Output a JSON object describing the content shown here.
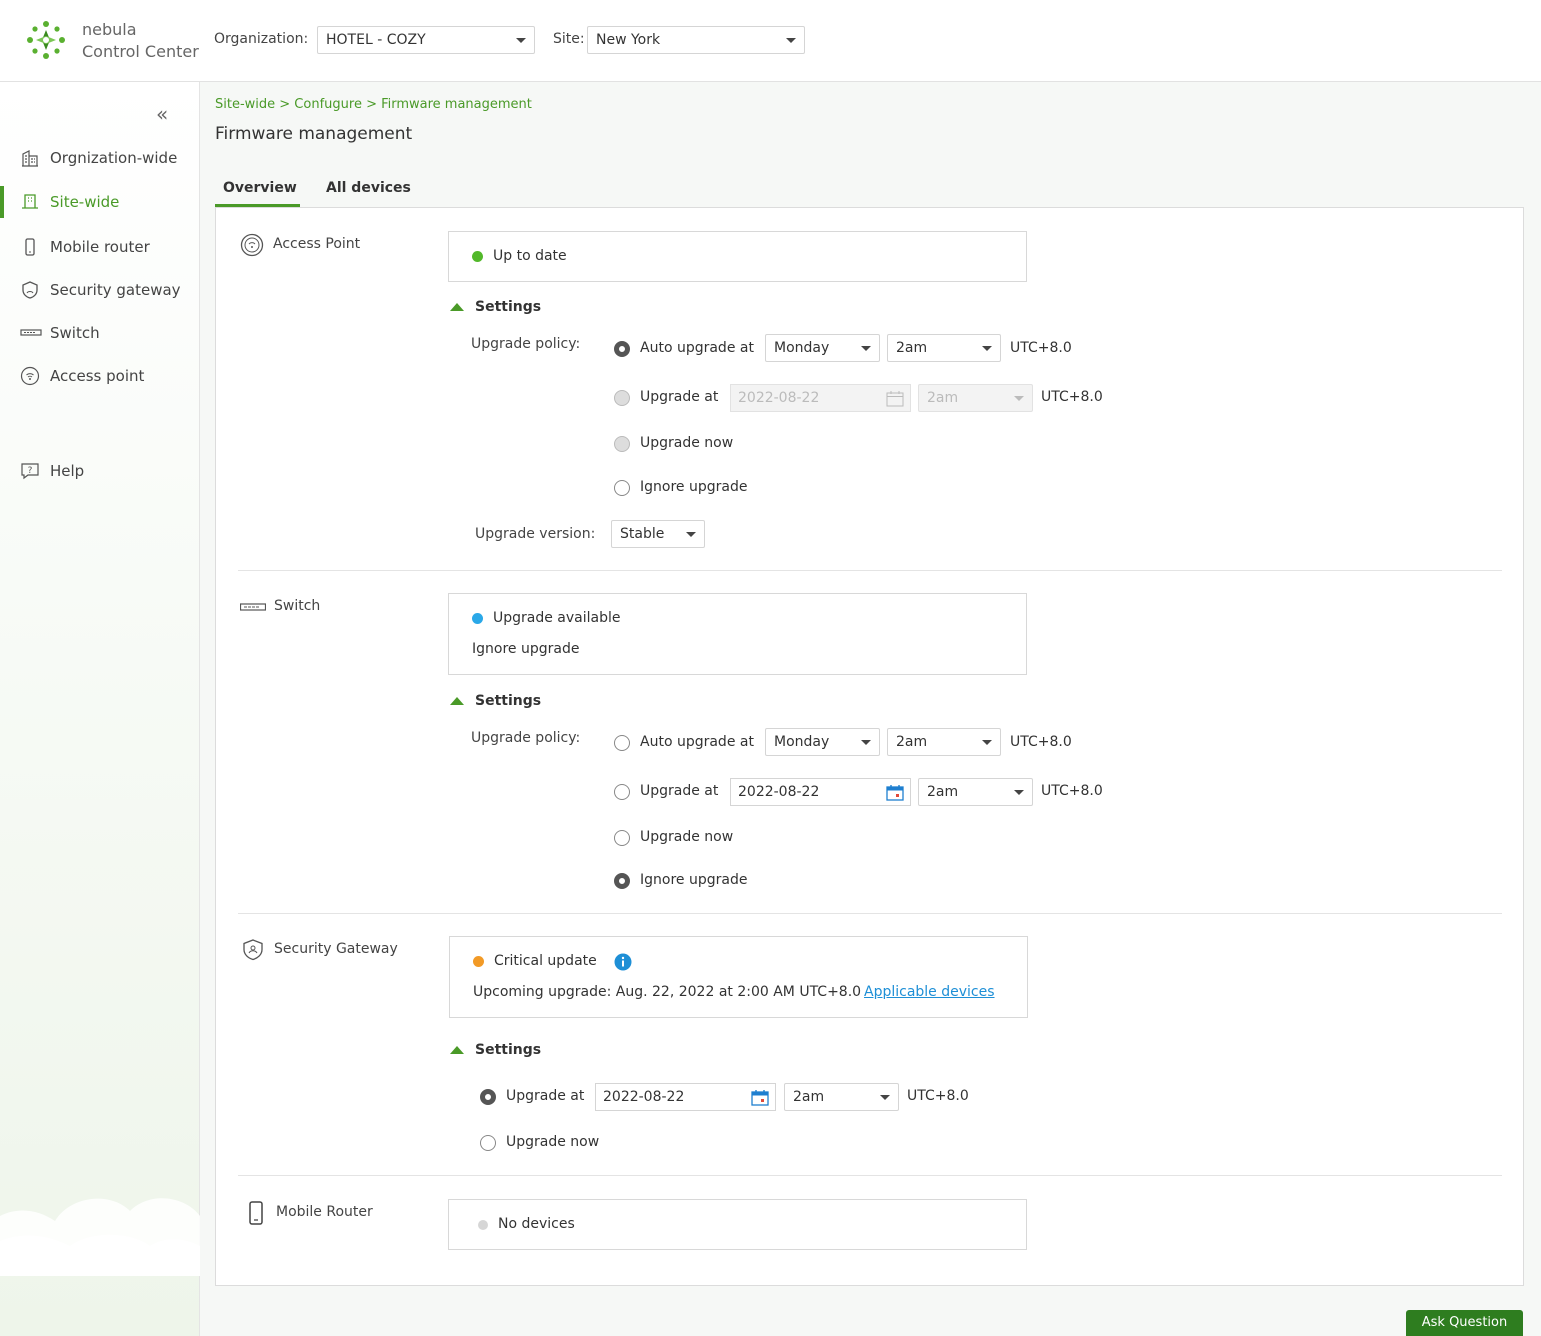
{
  "header": {
    "brand_line1": "nebula",
    "brand_line2": "Control Center",
    "org_label": "Organization:",
    "org_value": "HOTEL - COZY",
    "site_label": "Site:",
    "site_value": "New York"
  },
  "sidebar": {
    "collapse_glyph": "«",
    "items": [
      {
        "label": "Orgnization-wide",
        "icon": "building-icon"
      },
      {
        "label": "Site-wide",
        "icon": "site-icon",
        "active": true
      },
      {
        "label": "Mobile router",
        "icon": "mobile-icon"
      },
      {
        "label": "Security gateway",
        "icon": "shield-icon"
      },
      {
        "label": "Switch",
        "icon": "switch-icon"
      },
      {
        "label": "Access point",
        "icon": "access-point-icon"
      },
      {
        "label": "Help",
        "icon": "help-icon"
      }
    ]
  },
  "breadcrumb": "Site-wide > Confugure > Firmware management",
  "page_title": "Firmware management",
  "tabs": [
    {
      "label": "Overview",
      "active": true
    },
    {
      "label": "All devices"
    }
  ],
  "common": {
    "settings_label": "Settings",
    "upgrade_policy_label": "Upgrade policy:",
    "upgrade_version_label": "Upgrade version:",
    "auto_upgrade_label": "Auto upgrade at",
    "upgrade_at_label": "Upgrade at",
    "upgrade_now_label": "Upgrade now",
    "ignore_upgrade_label": "Ignore upgrade",
    "timezone": "UTC+8.0"
  },
  "access_point": {
    "title": "Access Point",
    "status": "Up to date",
    "status_color": "#52b82a",
    "day": "Monday",
    "time": "2am",
    "date": "2022-08-22",
    "date_time": "2am",
    "version": "Stable",
    "selected_policy": "auto"
  },
  "switch": {
    "title": "Switch",
    "status": "Upgrade available",
    "status_color": "#2aa8e8",
    "sub_status": "Ignore upgrade",
    "day": "Monday",
    "time": "2am",
    "date": "2022-08-22",
    "date_time": "2am",
    "selected_policy": "ignore"
  },
  "security_gateway": {
    "title": "Security Gateway",
    "status": "Critical update",
    "status_color": "#f29a26",
    "upcoming": "Upcoming upgrade: Aug. 22, 2022 at 2:00 AM UTC+8.0",
    "applicable_link": "Applicable devices",
    "date": "2022-08-22",
    "time": "2am",
    "selected_policy": "upgrade_at"
  },
  "mobile_router": {
    "title": "Mobile Router",
    "status": "No devices",
    "status_color": "#d0d0d0"
  },
  "ask_button": "Ask Question"
}
